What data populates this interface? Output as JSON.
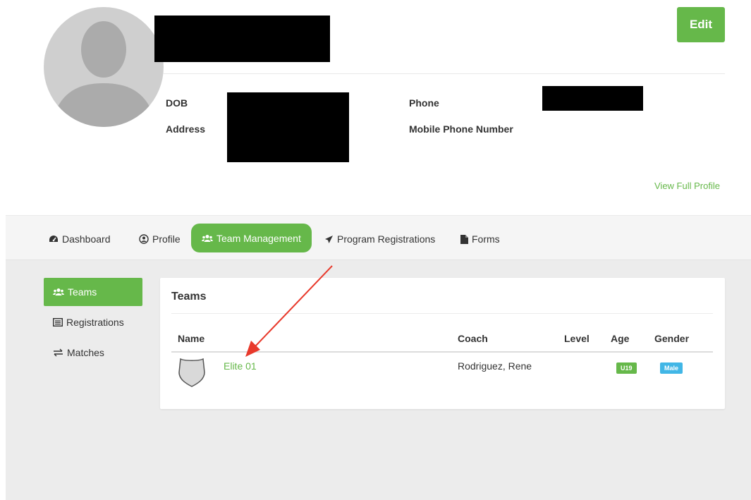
{
  "header": {
    "edit_label": "Edit",
    "dob_label": "DOB",
    "address_label": "Address",
    "phone_label": "Phone",
    "mobile_label": "Mobile Phone Number",
    "view_full_profile": "View Full Profile"
  },
  "nav": {
    "tabs": [
      {
        "label": "Dashboard",
        "icon": "dashboard-icon"
      },
      {
        "label": "Profile",
        "icon": "user-circle-icon"
      },
      {
        "label": "Team Management",
        "icon": "users-icon",
        "active": true
      },
      {
        "label": "Program Registrations",
        "icon": "paper-plane-icon"
      },
      {
        "label": "Forms",
        "icon": "file-icon"
      }
    ]
  },
  "sidebar": {
    "items": [
      {
        "label": "Teams",
        "icon": "users-icon",
        "active": true
      },
      {
        "label": "Registrations",
        "icon": "list-icon"
      },
      {
        "label": "Matches",
        "icon": "exchange-icon"
      }
    ]
  },
  "teams_panel": {
    "title": "Teams",
    "columns": [
      "Name",
      "Coach",
      "Level",
      "Age",
      "Gender"
    ],
    "rows": [
      {
        "name": "Elite 01",
        "coach": "Rodriguez, Rene",
        "level": "",
        "age": "U19",
        "gender": "Male"
      }
    ]
  },
  "colors": {
    "accent": "#66b84a",
    "info_badge": "#41b6e6",
    "annotation_arrow": "#e8392b",
    "content_bg": "#ececec"
  }
}
